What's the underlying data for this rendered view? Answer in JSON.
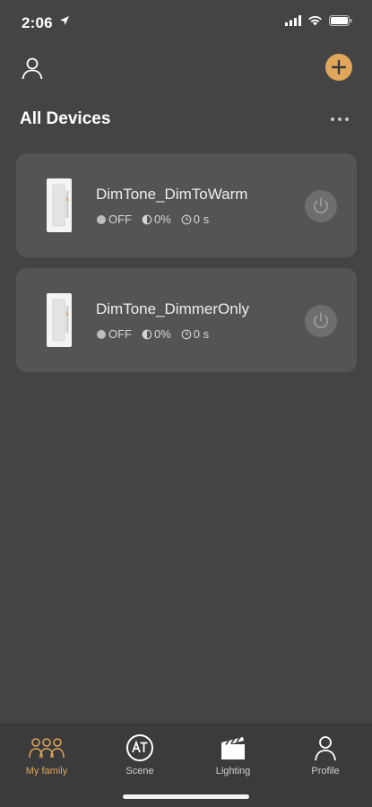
{
  "status_bar": {
    "time": "2:06"
  },
  "section": {
    "title": "All Devices"
  },
  "devices": [
    {
      "name": "DimTone_DimToWarm",
      "power": "OFF",
      "brightness": "0%",
      "timer": "0 s"
    },
    {
      "name": "DimTone_DimmerOnly",
      "power": "OFF",
      "brightness": "0%",
      "timer": "0 s"
    }
  ],
  "tabs": [
    {
      "label": "My family",
      "icon": "family-icon",
      "active": true
    },
    {
      "label": "Scene",
      "icon": "scene-icon",
      "active": false
    },
    {
      "label": "Lighting",
      "icon": "clapperboard-icon",
      "active": false
    },
    {
      "label": "Profile",
      "icon": "person-icon",
      "active": false
    }
  ],
  "colors": {
    "background": "#444444",
    "card": "#545454",
    "accent": "#e0a65c",
    "tab_bar": "#3b3b3b"
  }
}
